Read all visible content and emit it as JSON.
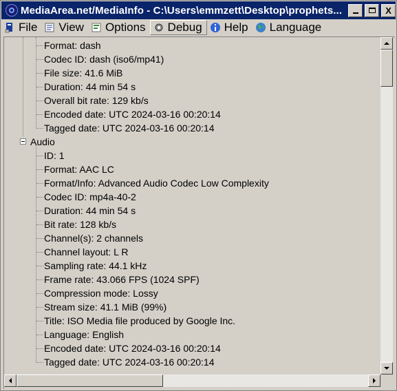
{
  "window": {
    "title": "MediaArea.net/MediaInfo - C:\\Users\\emmzett\\Desktop\\prophets...",
    "minimize_icon": "minimize-icon",
    "maximize_icon": "maximize-icon",
    "close_label": "X",
    "title_color": "#0a246a"
  },
  "menu": {
    "file": "File",
    "view": "View",
    "options": "Options",
    "debug": "Debug",
    "help": "Help",
    "language": "Language"
  },
  "tree": {
    "general_items": [
      "Format: dash",
      "Codec ID: dash (iso6/mp41)",
      "File size: 41.6 MiB",
      "Duration: 44 min 54 s",
      "Overall bit rate: 129 kb/s",
      "Encoded date: UTC 2024-03-16 00:20:14",
      "Tagged date: UTC 2024-03-16 00:20:14"
    ],
    "audio_label": "Audio",
    "audio_items": [
      "ID: 1",
      "Format: AAC LC",
      "Format/Info: Advanced Audio Codec Low Complexity",
      "Codec ID: mp4a-40-2",
      "Duration: 44 min 54 s",
      "Bit rate: 128 kb/s",
      "Channel(s): 2 channels",
      "Channel layout: L R",
      "Sampling rate: 44.1 kHz",
      "Frame rate: 43.066 FPS (1024 SPF)",
      "Compression mode: Lossy",
      "Stream size: 41.1 MiB (99%)",
      "Title: ISO Media file produced by Google Inc.",
      "Language: English",
      "Encoded date: UTC 2024-03-16 00:20:14",
      "Tagged date: UTC 2024-03-16 00:20:14"
    ]
  }
}
